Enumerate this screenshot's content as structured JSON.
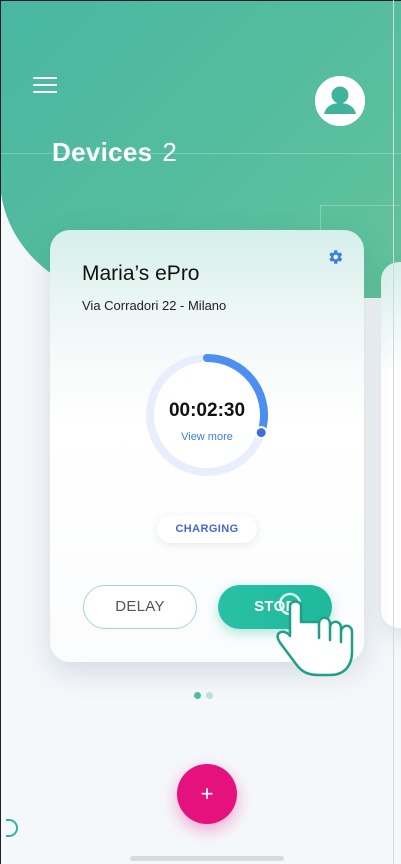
{
  "header": {
    "title": "Devices",
    "device_count": "2"
  },
  "device_card": {
    "name": "Maria’s ePro",
    "address": "Via Corradori 22 - Milano",
    "timer": "00:02:30",
    "view_more_label": "View more",
    "status": "CHARGING",
    "delay_label": "DELAY",
    "stop_label": "STOP",
    "progress_fraction": 0.3
  },
  "pagination": {
    "total_pages": 2,
    "active_page": 1
  },
  "fab": {
    "label": "+"
  },
  "colors": {
    "header_gradient_start": "#49b7a3",
    "header_gradient_end": "#62c39b",
    "accent_teal": "#29c1a5",
    "timer_blue": "#3c7ee6",
    "status_text": "#4466d6",
    "fab_pink": "#e5127e"
  },
  "icons": {
    "menu": "menu-icon",
    "avatar": "user-avatar-icon",
    "settings": "gear-icon",
    "tap_gesture": "hand-pointer-icon",
    "add": "plus-icon"
  }
}
